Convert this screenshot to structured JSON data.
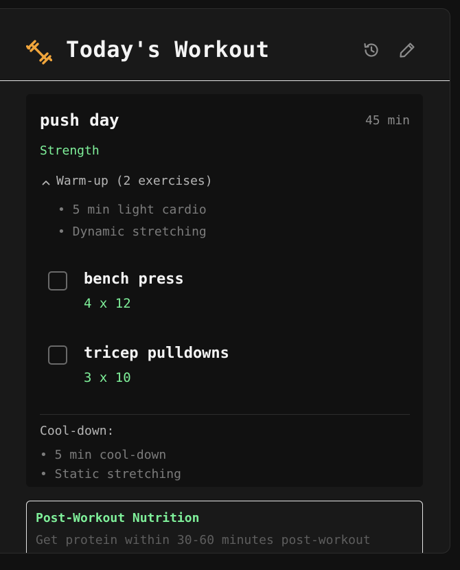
{
  "header": {
    "title": "Today's Workout",
    "icon": "dumbbell-icon",
    "actions": [
      {
        "name": "history",
        "icon": "history-icon"
      },
      {
        "name": "edit",
        "icon": "pencil-icon"
      }
    ]
  },
  "workout": {
    "name": "push day",
    "duration": "45 min",
    "type": "Strength",
    "warmup": {
      "label": "Warm-up (2 exercises)",
      "items": [
        "• 5 min light cardio",
        "• Dynamic stretching"
      ]
    },
    "exercises": [
      {
        "name": "bench press",
        "sets": "4 x 12",
        "checked": false
      },
      {
        "name": "tricep pulldowns",
        "sets": "3 x 10",
        "checked": false
      }
    ],
    "cooldown": {
      "label": "Cool-down:",
      "items": [
        "• 5 min cool-down",
        "• Static stretching"
      ]
    }
  },
  "nutrition": {
    "title": "Post-Workout Nutrition",
    "text": "Get protein within 30-60 minutes post-workout"
  },
  "colors": {
    "accent_green": "#7ff09a",
    "accent_orange": "#f0a53c",
    "background": "#111111",
    "card": "#191919"
  }
}
